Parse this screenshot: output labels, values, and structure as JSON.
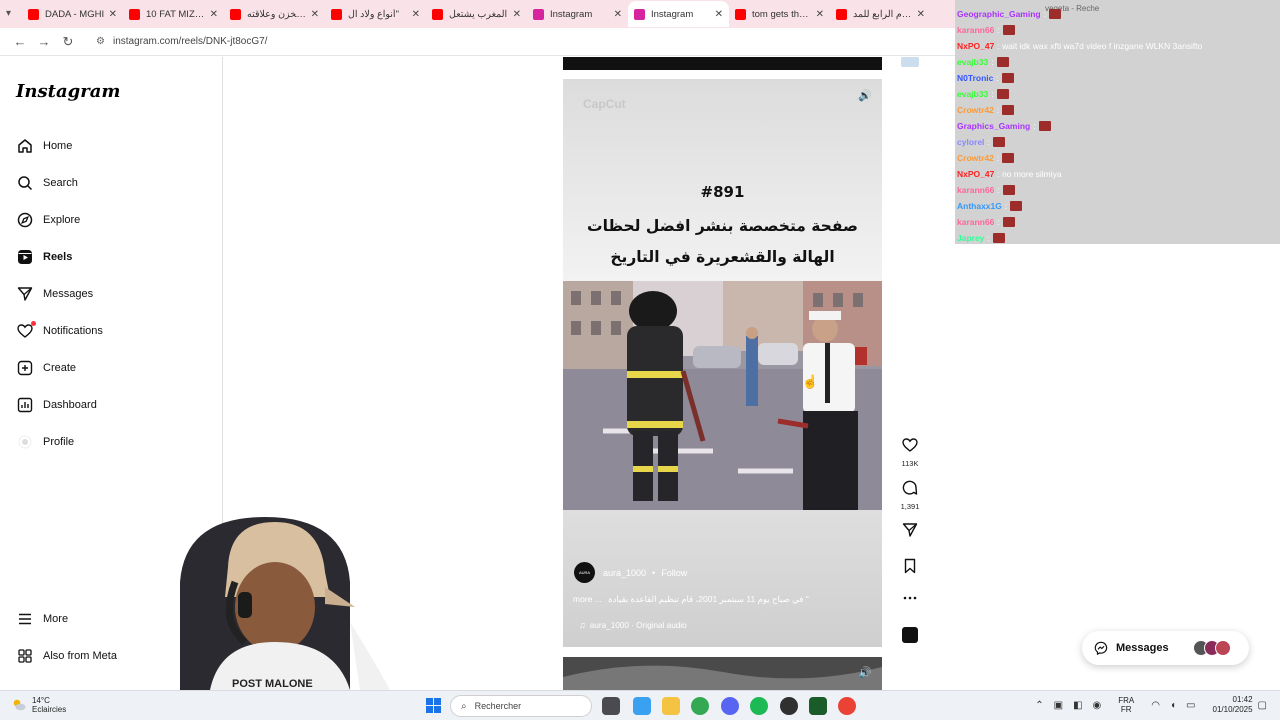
{
  "browser": {
    "tabs": [
      {
        "title": "DADA - MGHI",
        "favicon_color": "#ff0000"
      },
      {
        "title": "10 FAT MIZZO",
        "favicon_color": "#ff0000"
      },
      {
        "title": "المخزن وعلاقته",
        "favicon_color": "#ff0000"
      },
      {
        "title": "أنواع ولاد ال\"",
        "favicon_color": "#ff0000"
      },
      {
        "title": "المغرب يشتعل",
        "favicon_color": "#ff0000"
      },
      {
        "title": "Instagram",
        "favicon_color": "#d6249f"
      },
      {
        "title": "Instagram",
        "favicon_color": "#d6249f",
        "active": true
      },
      {
        "title": "tom gets throw",
        "favicon_color": "#ff0000"
      },
      {
        "title": "اليوم الرابع للمد",
        "favicon_color": "#ff0000"
      }
    ],
    "close_glyph": "✕",
    "url": "instagram.com/reels/DNK-jt8ocG7/"
  },
  "sidebar": {
    "logo": "Instagram",
    "items": [
      {
        "label": "Home",
        "icon": "home-icon"
      },
      {
        "label": "Search",
        "icon": "search-icon"
      },
      {
        "label": "Explore",
        "icon": "explore-icon"
      },
      {
        "label": "Reels",
        "icon": "reels-icon",
        "active": true
      },
      {
        "label": "Messages",
        "icon": "messages-icon"
      },
      {
        "label": "Notifications",
        "icon": "heart-icon"
      },
      {
        "label": "Create",
        "icon": "plus-icon"
      },
      {
        "label": "Dashboard",
        "icon": "dashboard-icon"
      },
      {
        "label": "Profile",
        "icon": "profile-icon"
      }
    ],
    "more": "More",
    "also_from_meta": "Also from Meta"
  },
  "reel": {
    "watermark": "CapCut",
    "hashtag": "#891",
    "caption_lines": [
      "صفحة متخصصة بنشر افضل لحظات",
      "الهالة والقشعريرة في التاريخ"
    ],
    "author": "aura_1000",
    "author_avatar_text": "AURA",
    "follow": "Follow",
    "description": "في صباح يوم 11 سبتمبر 2001، قام تنظيم القاعدة بقيادة \"",
    "more": "more ...",
    "audio": "aura_1000 · Original audio"
  },
  "actions": {
    "likes": "113K",
    "comments": "1,391"
  },
  "chat": {
    "ghost_text": "vegeta - Reche",
    "lines": [
      {
        "user": "NxPO_47",
        "color": "#ff2222",
        "text": ": wait idk wax xfti wa7d video f inzgane WLKN 3ansifto"
      },
      {
        "user": "evajb33",
        "color": "#33ff33",
        "text": ":"
      },
      {
        "user": "N0Tronic",
        "color": "#3355ff",
        "text": ":"
      },
      {
        "user": "evajb33",
        "color": "#33ff33",
        "text": ":"
      },
      {
        "user": "Crowtr42",
        "color": "#ff9933",
        "text": ":"
      },
      {
        "user": "Graphics_Gaming",
        "color": "#aa33ff",
        "text": ":"
      },
      {
        "user": "cylorel",
        "color": "#8888ff",
        "text": ":"
      },
      {
        "user": "Crowtr42",
        "color": "#ff9933",
        "text": ":"
      },
      {
        "user": "NxPO_47",
        "color": "#ff2222",
        "text": ": no more silmiya"
      },
      {
        "user": "karann66",
        "color": "#ff6699",
        "text": ":"
      },
      {
        "user": "Anthaxx1G",
        "color": "#3399ff",
        "text": ":"
      },
      {
        "user": "karann66",
        "color": "#ff6699",
        "text": ":"
      },
      {
        "user": "Japrey",
        "color": "#33ff99",
        "text": ":"
      }
    ],
    "top_lines": [
      {
        "user": "Geographic_Gaming",
        "color": "#aa33ff",
        "text": ":"
      },
      {
        "user": "karann66",
        "color": "#ff6699",
        "text": ":"
      }
    ]
  },
  "messages_pill": {
    "label": "Messages"
  },
  "taskbar": {
    "temperature": "14°C",
    "weather": "Eclaircies",
    "search_placeholder": "Rechercher",
    "lang_top": "FRA",
    "lang_bottom": "FR",
    "time": "01:42",
    "date": "01/10/2025"
  }
}
